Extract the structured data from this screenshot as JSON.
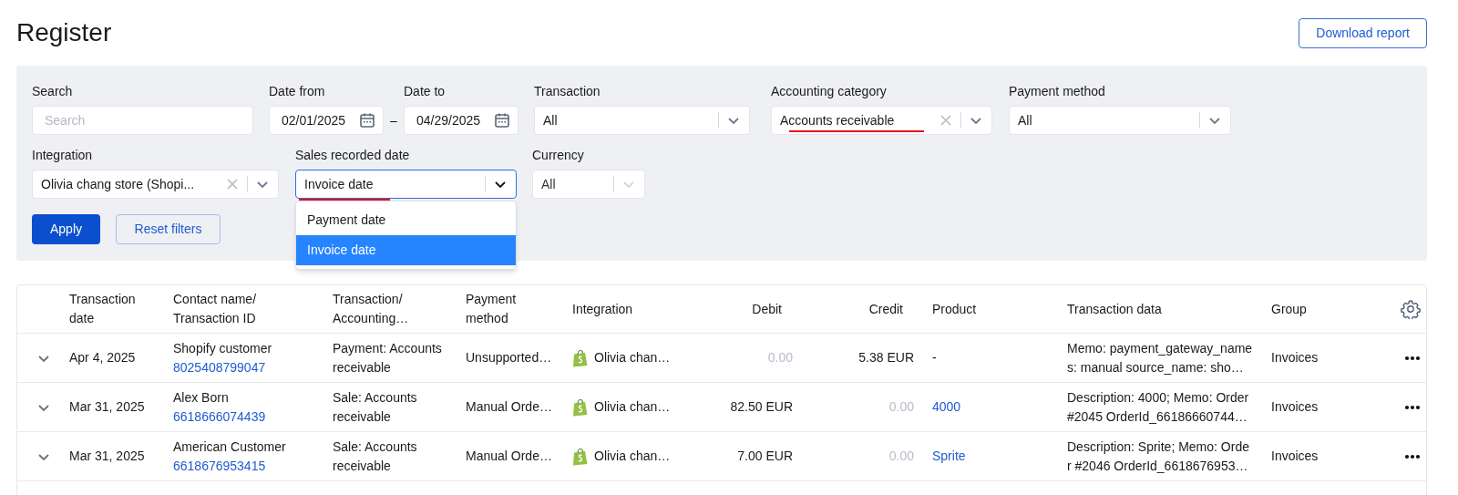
{
  "page": {
    "title": "Register",
    "download_button": "Download report"
  },
  "filters": {
    "row_1": [
      {
        "kind": "text",
        "label": "Search",
        "placeholder": "Search"
      },
      {
        "kind": "daterange",
        "label_from": "Date from",
        "label_to": "Date to",
        "from": "02/01/2025",
        "separator": "–",
        "to": "04/29/2025"
      },
      {
        "kind": "select",
        "label": "Transaction",
        "value": "All",
        "clearable": false
      },
      {
        "kind": "select",
        "label": "Accounting category",
        "value": "Accounts receivable",
        "clearable": true,
        "underlined": true
      },
      {
        "kind": "select",
        "label": "Payment method",
        "value": "All",
        "clearable": false
      }
    ],
    "row_2": [
      {
        "kind": "select",
        "label": "Integration",
        "value": "Olivia chang store (Shopi...",
        "clearable": true
      },
      {
        "kind": "open_select",
        "label": "Sales recorded date",
        "value": "Invoice date",
        "underlined": true,
        "options": [
          {
            "label": "Payment date",
            "selected": false
          },
          {
            "label": "Invoice date",
            "selected": true
          }
        ]
      },
      {
        "kind": "select",
        "label": "Currency",
        "value": "All",
        "clearable": false,
        "disabled": true
      }
    ],
    "apply_button": "Apply",
    "reset_button": "Reset filters"
  },
  "table": {
    "columns": [
      "Transaction date",
      "Contact name/ Transaction ID",
      "Transaction/ Accounting…",
      "Payment method",
      "Integration",
      "Debit",
      "Credit",
      "Product",
      "Transaction data",
      "Group"
    ],
    "rows": [
      {
        "date": "Apr 4, 2025",
        "contact": "Shopify customer",
        "transaction_id": "8025408799047",
        "transaction": "Payment: Accounts receivable",
        "payment_method": "Unsupported…",
        "integration": "Olivia chan…",
        "debit": "0.00",
        "debit_zero": true,
        "credit": "5.38 EUR",
        "credit_zero": false,
        "product": "-",
        "product_link": false,
        "transaction_data": "Memo: payment_gateway_names: manual source_name: sho…",
        "group": "Invoices"
      },
      {
        "date": "Mar 31, 2025",
        "contact": "Alex Born",
        "transaction_id": "6618666074439",
        "transaction": "Sale: Accounts receivable",
        "payment_method": "Manual Orde…",
        "integration": "Olivia chan…",
        "debit": "82.50 EUR",
        "debit_zero": false,
        "credit": "0.00",
        "credit_zero": true,
        "product": "4000",
        "product_link": true,
        "transaction_data": "Description: 4000; Memo: Order #2045 OrderId_66186660744…",
        "group": "Invoices"
      },
      {
        "date": "Mar 31, 2025",
        "contact": "American Customer",
        "transaction_id": "6618676953415",
        "transaction": "Sale: Accounts receivable",
        "payment_method": "Manual Orde…",
        "integration": "Olivia chan…",
        "debit": "7.00 EUR",
        "debit_zero": false,
        "credit": "0.00",
        "credit_zero": true,
        "product": "Sprite",
        "product_link": true,
        "transaction_data": "Description: Sprite; Memo: Order #2046 OrderId_6618676953…",
        "group": "Invoices"
      }
    ]
  }
}
